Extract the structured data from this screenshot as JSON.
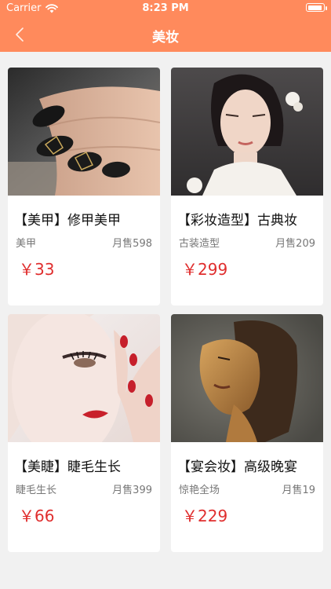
{
  "status_bar": {
    "carrier": "Carrier",
    "time": "8:23 PM"
  },
  "nav": {
    "title": "美妆"
  },
  "colors": {
    "header": "#ff8a5c",
    "price": "#e02e2e"
  },
  "products": [
    {
      "title": "【美甲】修甲美甲",
      "category": "美甲",
      "sales": "月售598",
      "price": "￥33"
    },
    {
      "title": "【彩妆造型】古典妆",
      "category": "古装造型",
      "sales": "月售209",
      "price": "￥299"
    },
    {
      "title": "【美睫】睫毛生长",
      "category": "睫毛生长",
      "sales": "月售399",
      "price": "￥66"
    },
    {
      "title": "【宴会妆】高级晚宴",
      "category": "惊艳全场",
      "sales": "月售19",
      "price": "￥229"
    }
  ]
}
